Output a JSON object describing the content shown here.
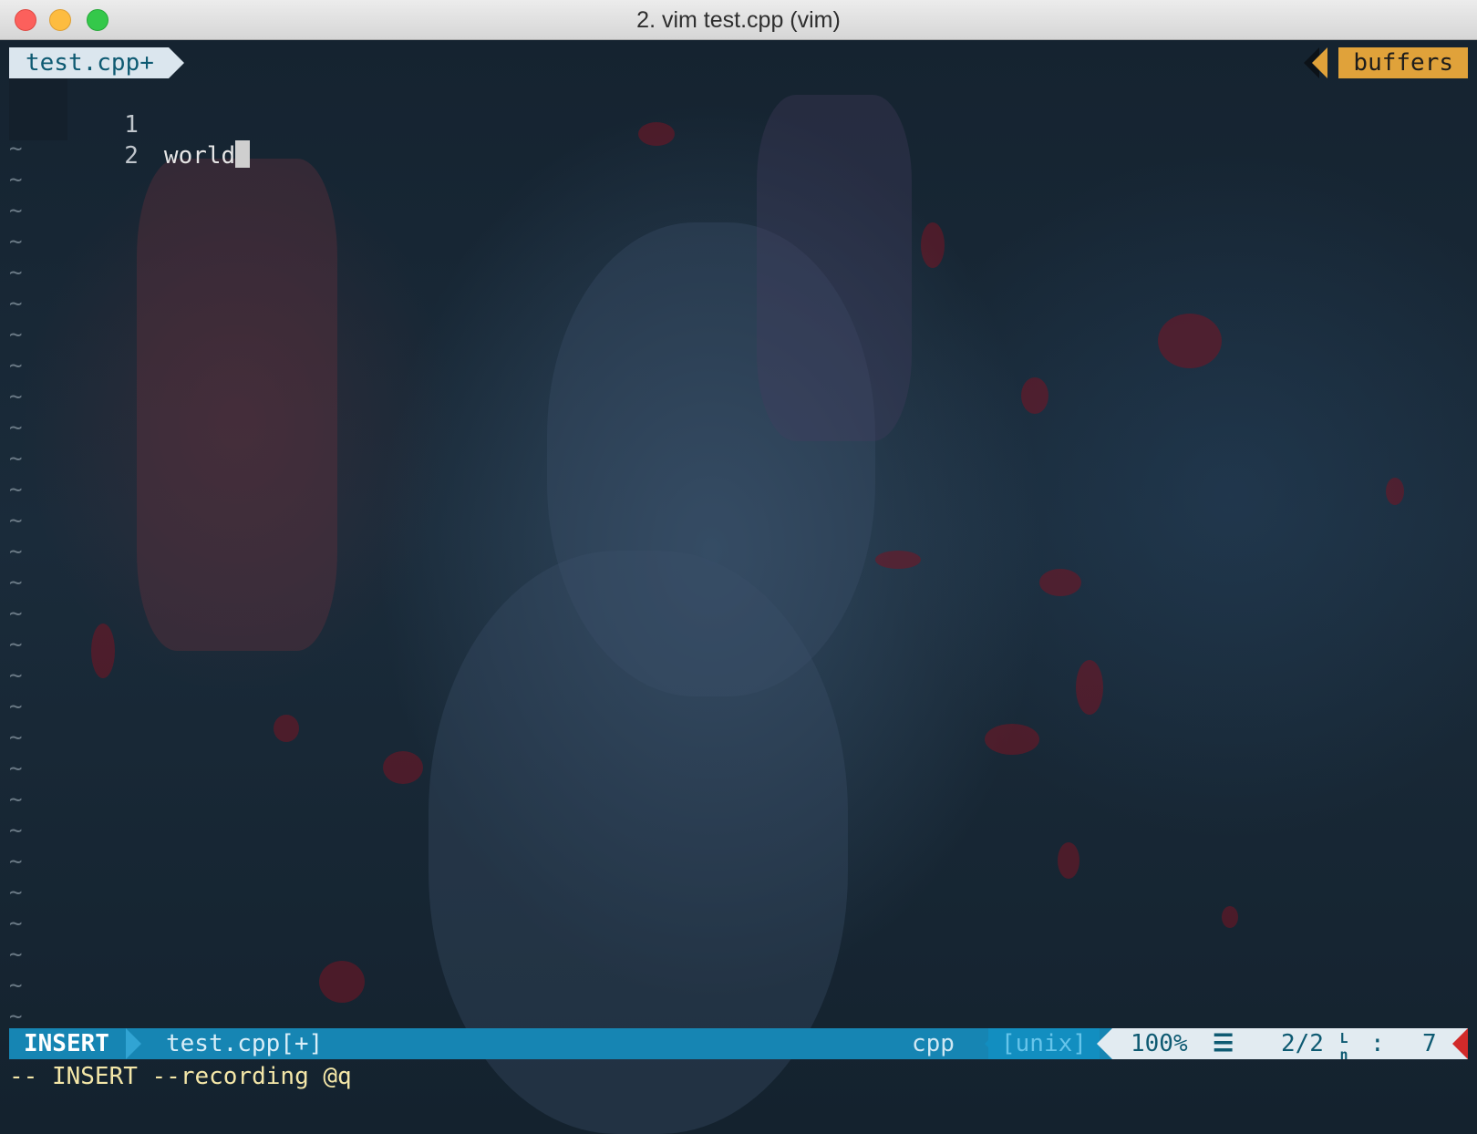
{
  "window": {
    "title": "2. vim test.cpp (vim)"
  },
  "tabline": {
    "active_tab": "test.cpp+",
    "buffers_label": "buffers"
  },
  "editor": {
    "lines": [
      {
        "number": "1",
        "text": ""
      },
      {
        "number": "2",
        "text": "world"
      }
    ],
    "empty_line_marker": "~"
  },
  "statusline": {
    "mode": "INSERT",
    "filename": "test.cpp[+]",
    "filetype": "cpp",
    "fileformat": "[unix]",
    "percent": "100%",
    "menu_glyph": "☰",
    "line_position": "2/2",
    "ln_glyph": "Ln",
    "separator": ":",
    "column": "7"
  },
  "cmdline": {
    "text": "-- INSERT --recording @q"
  },
  "colors": {
    "statusline": "#1685b3",
    "buffers": "#e0a23a",
    "tab_active": "#dbe6ee",
    "cmdline_text": "#f4e7a8"
  }
}
